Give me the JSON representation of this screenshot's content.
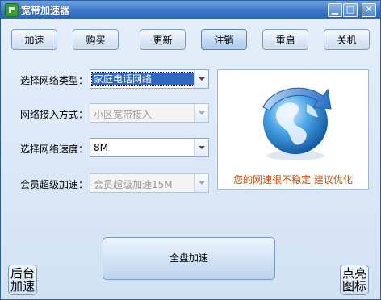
{
  "window": {
    "title": "宽带加速器",
    "minimize_glyph": "▁",
    "maximize_glyph": "□",
    "close_glyph": "✕"
  },
  "toolbar": {
    "buttons": [
      "加速",
      "购买",
      "更新",
      "注销",
      "重启",
      "关机"
    ],
    "active_index": 3
  },
  "form": {
    "network_type": {
      "label": "选择网络类型：",
      "value": "家庭电话网络",
      "enabled": true,
      "selected": true
    },
    "access_mode": {
      "label": "网络接入方式：",
      "value": "小区宽带接入",
      "enabled": false
    },
    "network_speed": {
      "label": "选择网络速度：",
      "value": "8M",
      "enabled": true
    },
    "member_boost": {
      "label": "会员超级加速：",
      "value": "会员超级加速15M",
      "enabled": false
    }
  },
  "status_panel": {
    "message": "您的网速很不稳定 建议优化",
    "message_color": "#d24c00",
    "icon": "globe-arrow-icon"
  },
  "main_action": {
    "label": "全盘加速"
  },
  "corner_buttons": {
    "left": [
      "后台",
      "加速"
    ],
    "right": [
      "点亮",
      "图标"
    ]
  },
  "colors": {
    "titlebar": "#3b77c9",
    "selection": "#3067c1",
    "panel_bg": "#ffffff"
  }
}
